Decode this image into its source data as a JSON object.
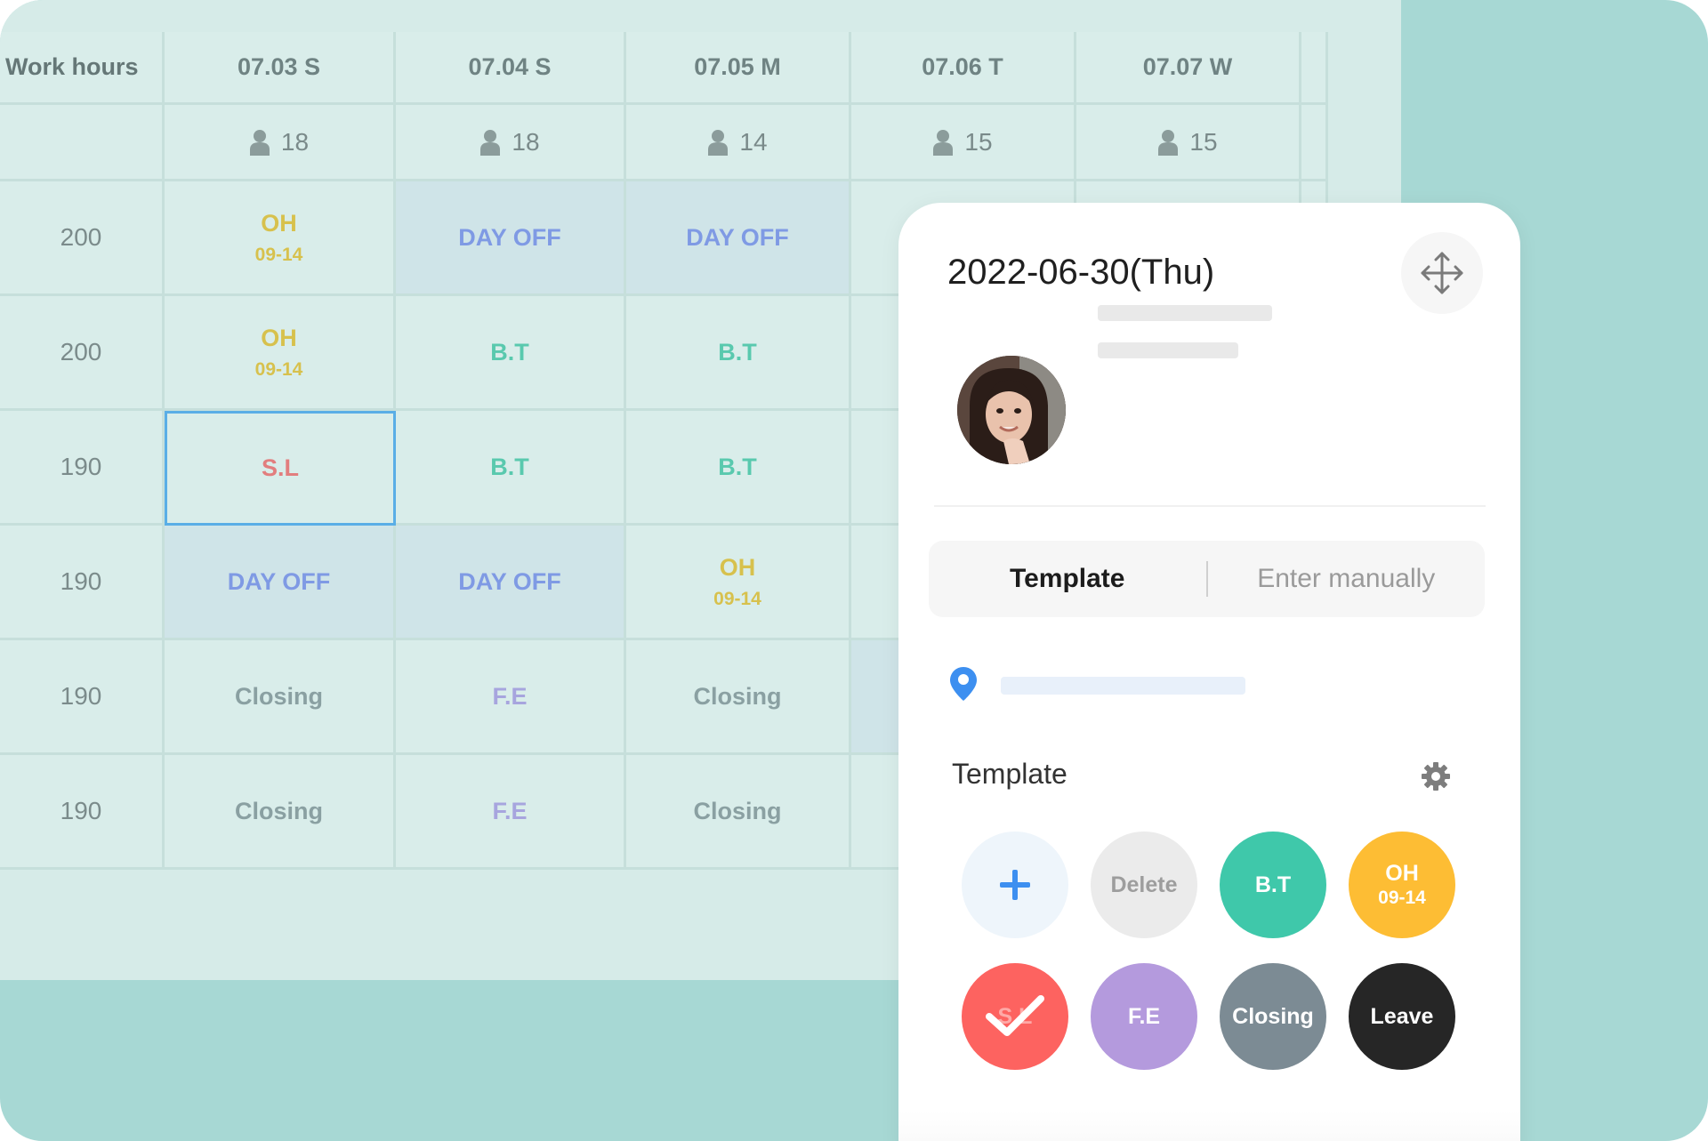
{
  "grid": {
    "header": [
      "Work hours",
      "07.03 S",
      "07.04 S",
      "07.05 M",
      "07.06 T",
      "07.07 W"
    ],
    "counts": [
      "18",
      "18",
      "14",
      "15",
      "15"
    ],
    "rows": [
      {
        "hours": "200",
        "cells": [
          {
            "label": "OH",
            "sub": "09-14",
            "type": "oh"
          },
          {
            "label": "DAY OFF",
            "type": "dayoff"
          },
          {
            "label": "DAY OFF",
            "type": "dayoff"
          }
        ]
      },
      {
        "hours": "200",
        "cells": [
          {
            "label": "OH",
            "sub": "09-14",
            "type": "oh"
          },
          {
            "label": "B.T",
            "type": "bt"
          },
          {
            "label": "B.T",
            "type": "bt"
          }
        ]
      },
      {
        "hours": "190",
        "cells": [
          {
            "label": "S.L",
            "type": "sl"
          },
          {
            "label": "B.T",
            "type": "bt"
          },
          {
            "label": "B.T",
            "type": "bt"
          }
        ]
      },
      {
        "hours": "190",
        "cells": [
          {
            "label": "DAY OFF",
            "type": "dayoff"
          },
          {
            "label": "DAY OFF",
            "type": "dayoff"
          },
          {
            "label": "OH",
            "sub": "09-14",
            "type": "oh"
          }
        ]
      },
      {
        "hours": "190",
        "cells": [
          {
            "label": "Closing",
            "type": "closing"
          },
          {
            "label": "F.E",
            "type": "fe"
          },
          {
            "label": "Closing",
            "type": "closing"
          }
        ]
      },
      {
        "hours": "190",
        "cells": [
          {
            "label": "Closing",
            "type": "closing"
          },
          {
            "label": "F.E",
            "type": "fe"
          },
          {
            "label": "Closing",
            "type": "closing"
          }
        ]
      }
    ]
  },
  "panel": {
    "date": "2022-06-30(Thu)",
    "tabs": {
      "template": "Template",
      "manual": "Enter manually"
    },
    "template_title": "Template",
    "buttons": {
      "delete": "Delete",
      "bt": "B.T",
      "oh": "OH",
      "oh_sub": "09-14",
      "sl": "S.L",
      "fe": "F.E",
      "closing": "Closing",
      "leave": "Leave"
    }
  },
  "colors": {
    "background": "#a7d8d4",
    "bt": "#3fc8aa",
    "oh": "#fdbd34",
    "sl": "#fd6360",
    "fe": "#b49add",
    "closing": "#7c8b94",
    "leave": "#262626",
    "accent": "#3d8ff0"
  }
}
